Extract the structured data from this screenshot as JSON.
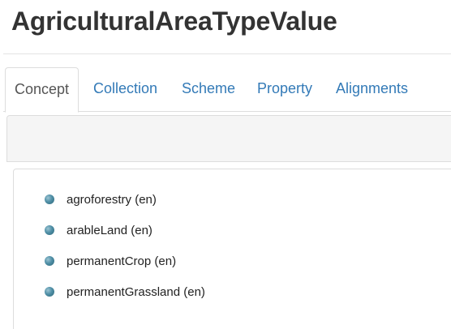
{
  "header": {
    "title": "AgriculturalAreaTypeValue"
  },
  "tabs": [
    {
      "label": "Concept",
      "active": true
    },
    {
      "label": "Collection",
      "active": false
    },
    {
      "label": "Scheme",
      "active": false
    },
    {
      "label": "Property",
      "active": false
    },
    {
      "label": "Alignments",
      "active": false
    }
  ],
  "concepts": [
    {
      "label": "agroforestry (en)",
      "icon": "bullet-icon"
    },
    {
      "label": "arableLand (en)",
      "icon": "bullet-icon"
    },
    {
      "label": "permanentCrop (en)",
      "icon": "bullet-icon"
    },
    {
      "label": "permanentGrassland (en)",
      "icon": "bullet-icon"
    }
  ],
  "colors": {
    "link": "#337ab7",
    "active_tab_text": "#555555",
    "title_text": "#333333",
    "bullet": "#4f8fa6",
    "panel_bg": "#f5f5f5",
    "border": "#dddddd"
  }
}
